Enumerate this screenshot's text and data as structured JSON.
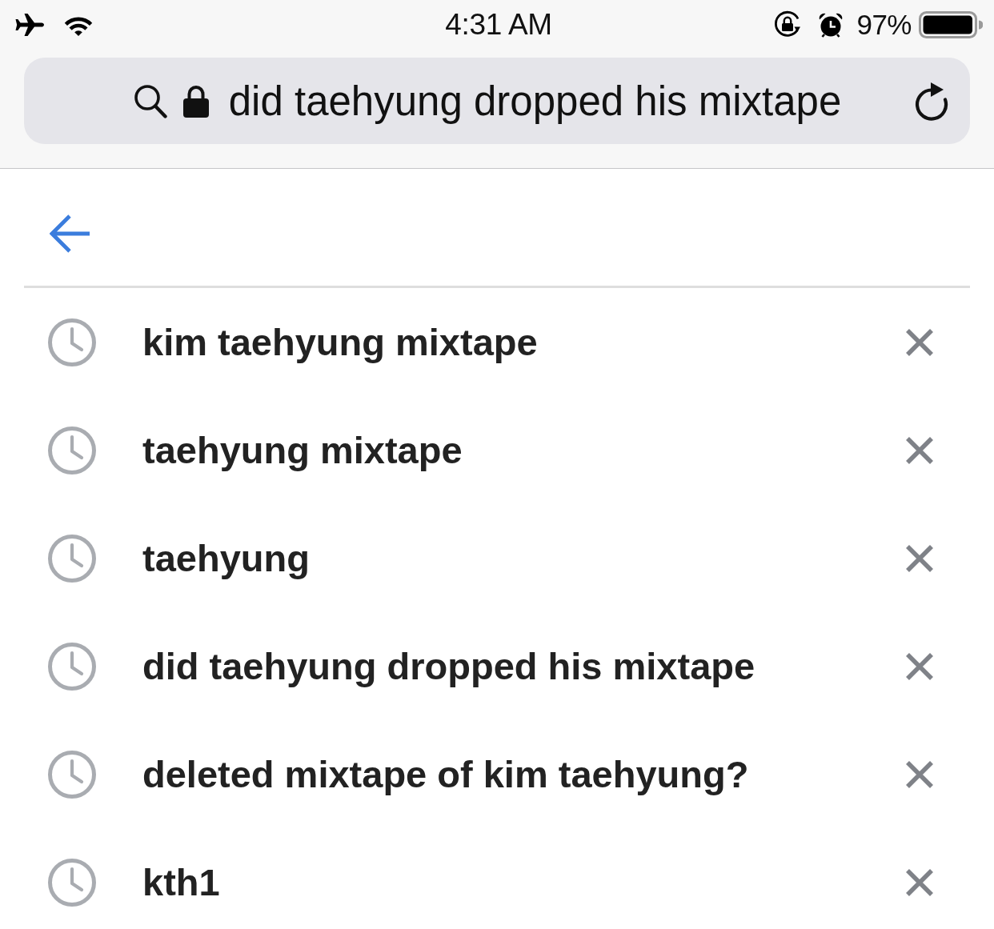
{
  "status_bar": {
    "time": "4:31 AM",
    "battery": "97%"
  },
  "address_bar": {
    "value": "did taehyung dropped his mixtape"
  },
  "history": [
    {
      "query": "kim taehyung mixtape"
    },
    {
      "query": "taehyung mixtape"
    },
    {
      "query": "taehyung"
    },
    {
      "query": "did taehyung dropped his mixtape"
    },
    {
      "query": "deleted mixtape of kim taehyung?"
    },
    {
      "query": "kth1"
    }
  ]
}
